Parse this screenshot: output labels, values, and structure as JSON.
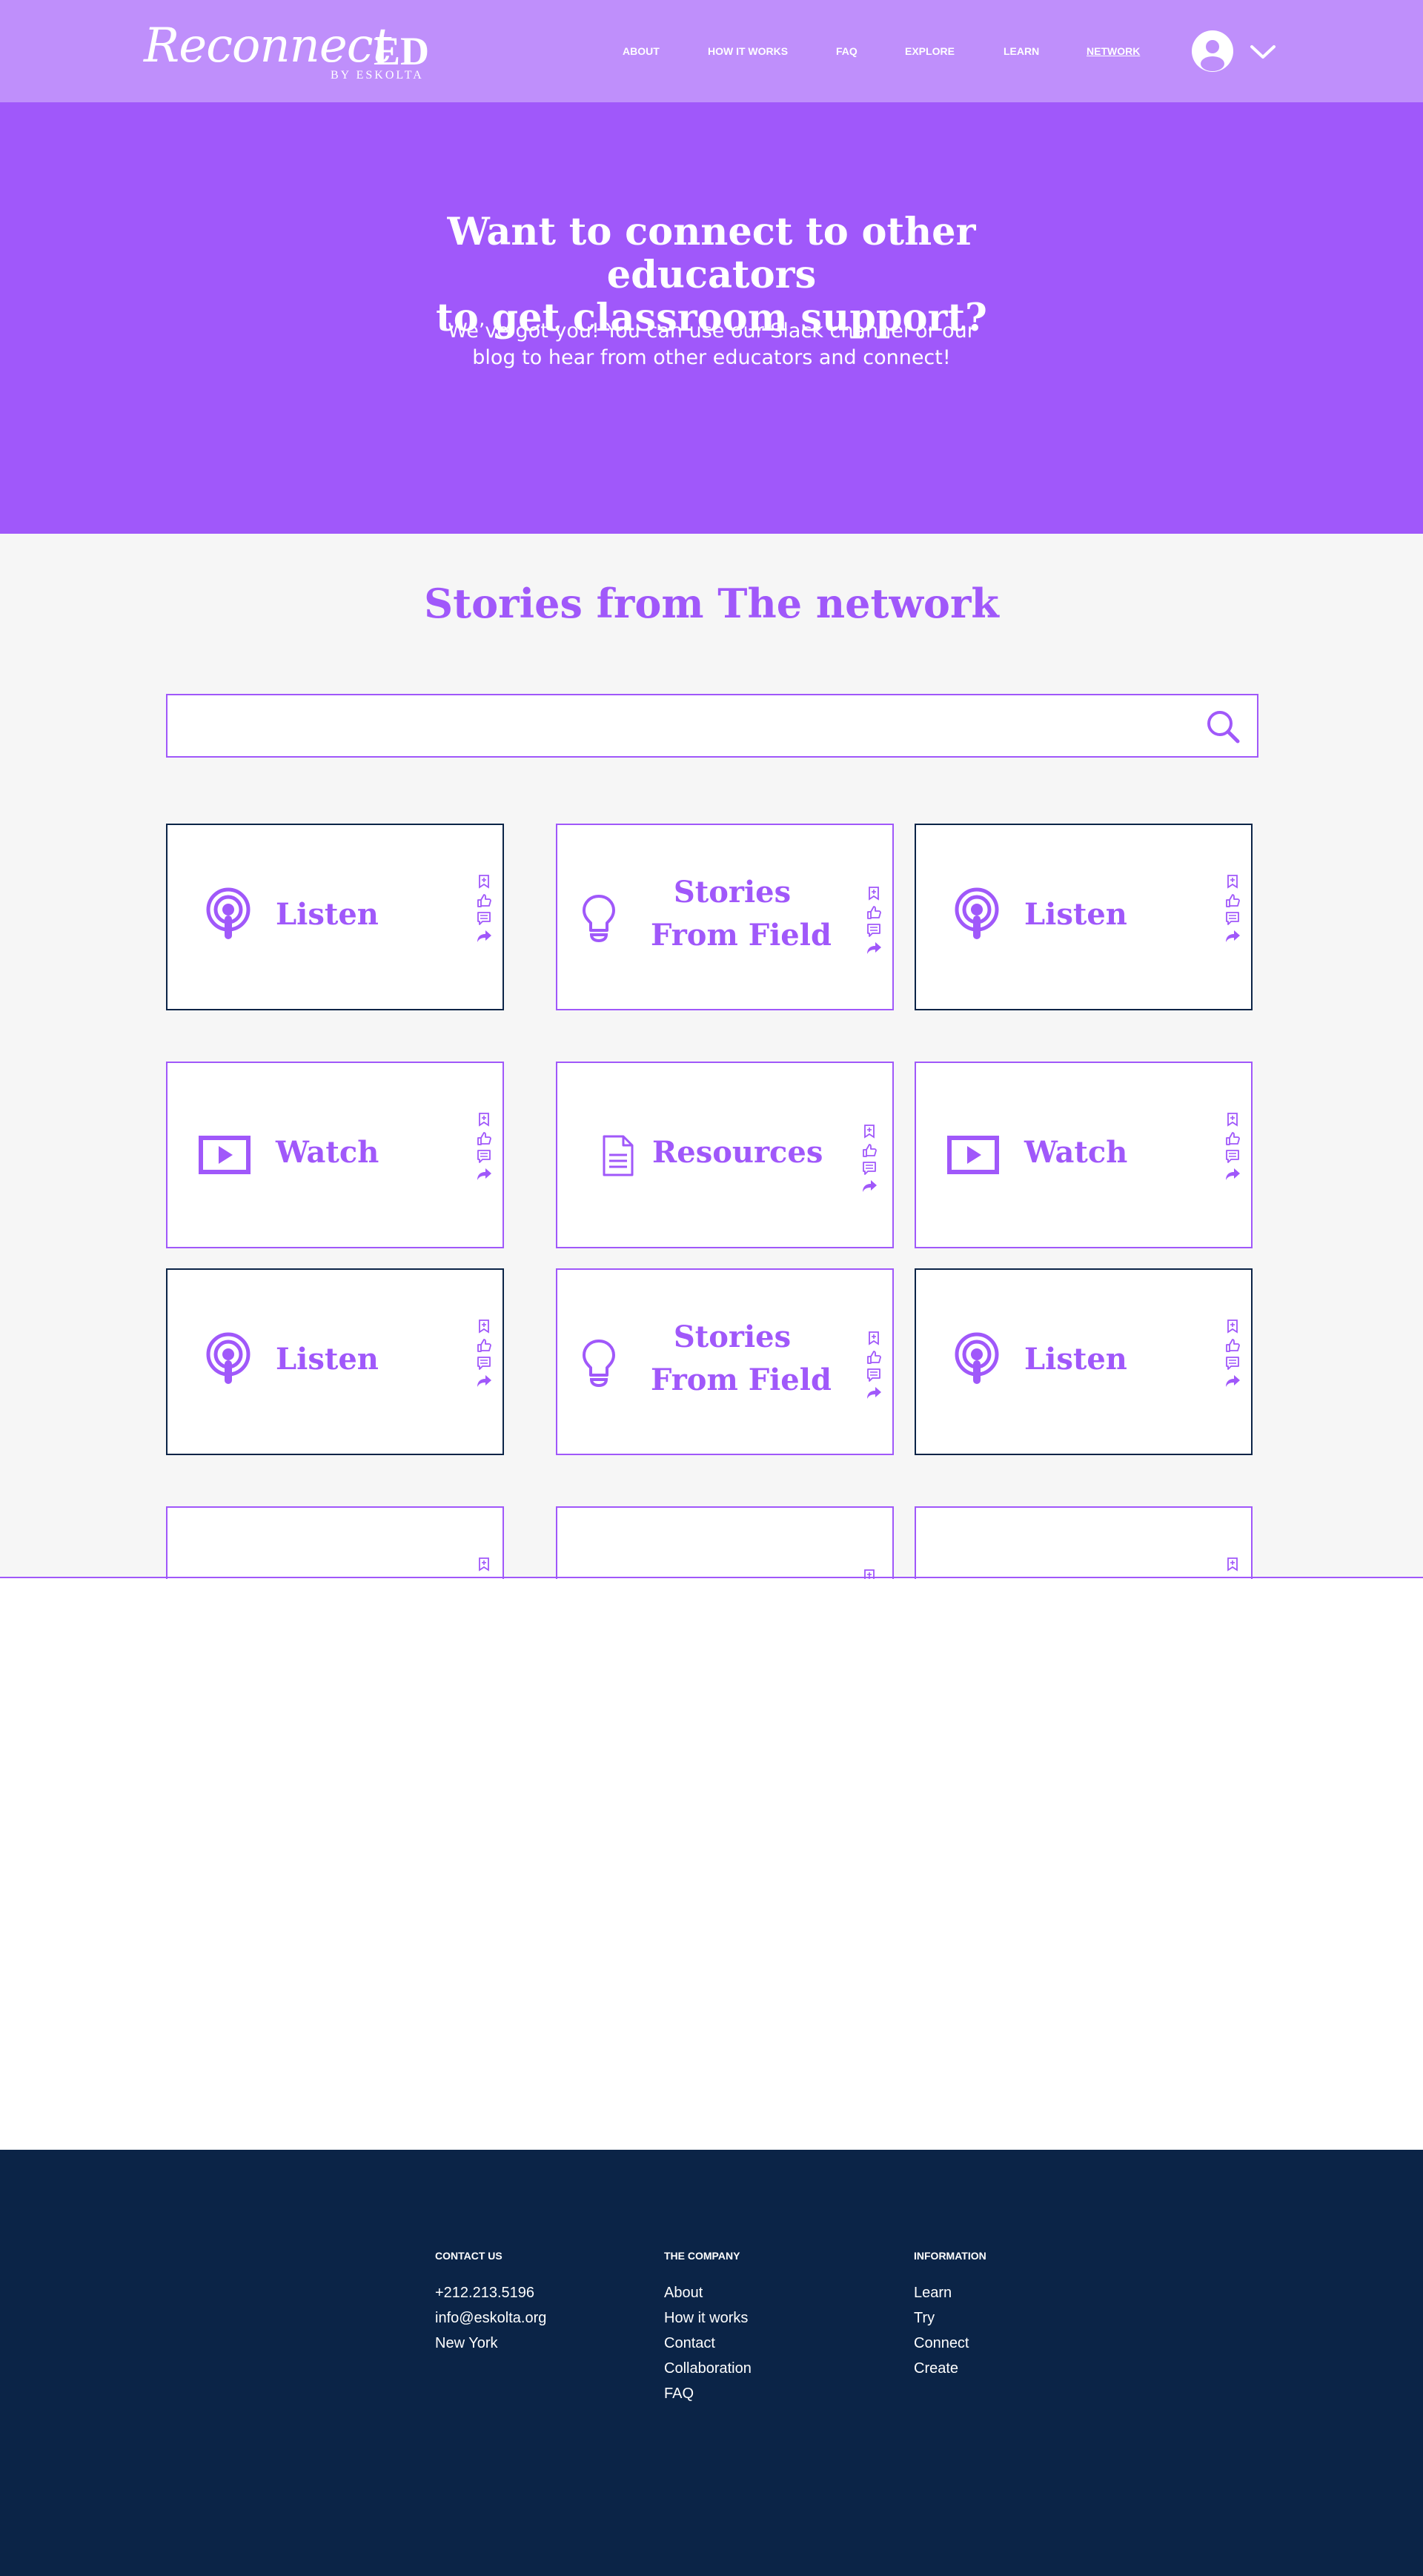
{
  "header": {
    "logo": {
      "script": "Reconnect",
      "suffix": "ED",
      "byline": "BY ESKOLTA"
    },
    "nav": [
      "ABOUT",
      "HOW IT WORKS",
      "FAQ",
      "EXPLORE",
      "LEARN",
      "NETWORK"
    ],
    "active_nav": "NETWORK",
    "account_icon": "user-avatar-icon",
    "menu_icon": "chevron-down-icon"
  },
  "hero": {
    "title_line1": "Want to connect to other educators",
    "title_line2": "to get classroom support?",
    "subtitle_line1": "We’ve got you! You can use our Slack channel or our",
    "subtitle_line2": "blog to hear from other educators and connect!"
  },
  "stories": {
    "title": "Stories from The network",
    "search": {
      "value": "",
      "placeholder": "",
      "icon": "search-icon"
    },
    "card_actions": [
      "bookmark-icon",
      "like-icon",
      "comment-icon",
      "share-icon"
    ],
    "cards": [
      {
        "label": "Listen",
        "icon": "podcast-icon"
      },
      {
        "label_line1": "Stories",
        "label_line2": "From Field",
        "icon": "lightbulb-icon"
      },
      {
        "label": "Listen",
        "icon": "podcast-icon"
      },
      {
        "label": "Watch",
        "icon": "video-icon"
      },
      {
        "label": "Resources",
        "icon": "document-icon"
      },
      {
        "label": "Watch",
        "icon": "video-icon"
      },
      {
        "label": "Listen",
        "icon": "podcast-icon"
      },
      {
        "label_line1": "Stories",
        "label_line2": "From Field",
        "icon": "lightbulb-icon"
      },
      {
        "label": "Listen",
        "icon": "podcast-icon"
      }
    ]
  },
  "footer": {
    "contact": {
      "heading": "CONTACT US",
      "items": [
        "+212.213.5196",
        "info@eskolta.org",
        "New York"
      ]
    },
    "company": {
      "heading": "THE COMPANY",
      "items": [
        "About",
        "How it works",
        "Contact",
        "Collaboration",
        "FAQ"
      ]
    },
    "information": {
      "heading": "INFORMATION",
      "items": [
        "Learn",
        "Try",
        "Connect",
        "Create"
      ]
    }
  },
  "colors": {
    "header": "#bf8ffb",
    "hero": "#a058fa",
    "accent": "#a058fa",
    "section_bg": "#f6f6f6",
    "footer": "#0b2447",
    "dark_border": "#0b2447"
  }
}
